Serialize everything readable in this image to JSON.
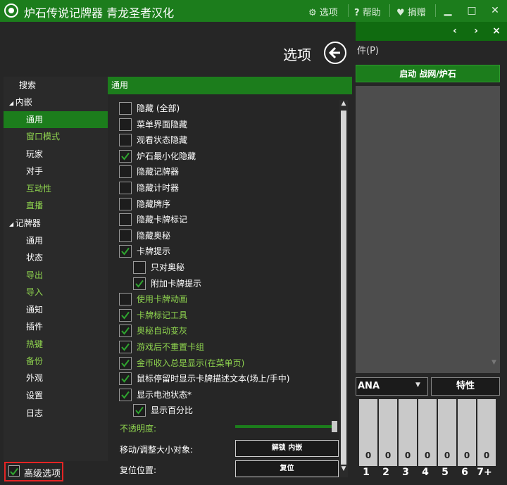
{
  "window": {
    "title": "炉石传说记牌器 青龙圣者汉化",
    "options_link": "选项",
    "help_link": "帮助",
    "donate_link": "捐赠"
  },
  "background": {
    "menu_fragment": "件(P)",
    "launch_button": "启动 战网/炉石",
    "mana_select": "ANA",
    "feature_button": "特性",
    "mana_counts": [
      "0",
      "0",
      "0",
      "0",
      "0",
      "0",
      "0"
    ],
    "mana_labels": [
      "1",
      "2",
      "3",
      "4",
      "5",
      "6",
      "7+"
    ]
  },
  "options": {
    "title": "选项",
    "sidebar": [
      {
        "label": "搜索",
        "style": "top"
      },
      {
        "label": "内嵌",
        "style": "group",
        "expanded": true
      },
      {
        "label": "通用",
        "style": "child",
        "selected": true
      },
      {
        "label": "窗口模式",
        "style": "child-green"
      },
      {
        "label": "玩家",
        "style": "child"
      },
      {
        "label": "对手",
        "style": "child"
      },
      {
        "label": "互动性",
        "style": "child-green"
      },
      {
        "label": "直播",
        "style": "child-green"
      },
      {
        "label": "记牌器",
        "style": "group",
        "expanded": true
      },
      {
        "label": "通用",
        "style": "child"
      },
      {
        "label": "状态",
        "style": "child"
      },
      {
        "label": "导出",
        "style": "child-green"
      },
      {
        "label": "导入",
        "style": "child-green"
      },
      {
        "label": "通知",
        "style": "child"
      },
      {
        "label": "插件",
        "style": "child"
      },
      {
        "label": "热键",
        "style": "child-green"
      },
      {
        "label": "备份",
        "style": "child-green"
      },
      {
        "label": "外观",
        "style": "child"
      },
      {
        "label": "设置",
        "style": "child"
      },
      {
        "label": "日志",
        "style": "child"
      }
    ],
    "advanced": {
      "label": "高级选项",
      "checked": true
    },
    "section_header": "通用",
    "checkboxes": [
      {
        "label": "隐藏 (全部)",
        "checked": false,
        "indent": 0,
        "color": "white"
      },
      {
        "label": "菜单界面隐藏",
        "checked": false,
        "indent": 0,
        "color": "white"
      },
      {
        "label": "观看状态隐藏",
        "checked": false,
        "indent": 0,
        "color": "white"
      },
      {
        "label": "炉石最小化隐藏",
        "checked": true,
        "indent": 0,
        "color": "white"
      },
      {
        "label": "隐藏记牌器",
        "checked": false,
        "indent": 0,
        "color": "white"
      },
      {
        "label": "隐藏计时器",
        "checked": false,
        "indent": 0,
        "color": "white"
      },
      {
        "label": "隐藏牌序",
        "checked": false,
        "indent": 0,
        "color": "white"
      },
      {
        "label": "隐藏卡牌标记",
        "checked": false,
        "indent": 0,
        "color": "white"
      },
      {
        "label": "隐藏奥秘",
        "checked": false,
        "indent": 0,
        "color": "white"
      },
      {
        "label": "卡牌提示",
        "checked": true,
        "indent": 0,
        "color": "white"
      },
      {
        "label": "只对奥秘",
        "checked": false,
        "indent": 1,
        "color": "white"
      },
      {
        "label": "附加卡牌提示",
        "checked": true,
        "indent": 1,
        "color": "white"
      },
      {
        "label": "使用卡牌动画",
        "checked": false,
        "indent": 0,
        "color": "green"
      },
      {
        "label": "卡牌标记工具",
        "checked": true,
        "indent": 0,
        "color": "green"
      },
      {
        "label": "奥秘自动变灰",
        "checked": true,
        "indent": 0,
        "color": "green"
      },
      {
        "label": "游戏后不重置卡组",
        "checked": true,
        "indent": 0,
        "color": "green"
      },
      {
        "label": "金币收入总是显示(在菜单页)",
        "checked": true,
        "indent": 0,
        "color": "green"
      },
      {
        "label": "鼠标停留时显示卡牌描述文本(场上/手中)",
        "checked": true,
        "indent": 0,
        "color": "white"
      },
      {
        "label": "显示电池状态*",
        "checked": true,
        "indent": 0,
        "color": "white"
      },
      {
        "label": "显示百分比",
        "checked": true,
        "indent": 1,
        "color": "white"
      }
    ],
    "opacity_label": "不透明度:",
    "opacity_value": 0.98,
    "move_label": "移动/调整大小对象:",
    "move_button": "解锁 内嵌",
    "reset_label": "复位位置:",
    "reset_button": "复位"
  },
  "colors": {
    "accent": "#1c7d1c",
    "highlight_text": "#8fd44f",
    "advanced_outline": "#e52424"
  }
}
